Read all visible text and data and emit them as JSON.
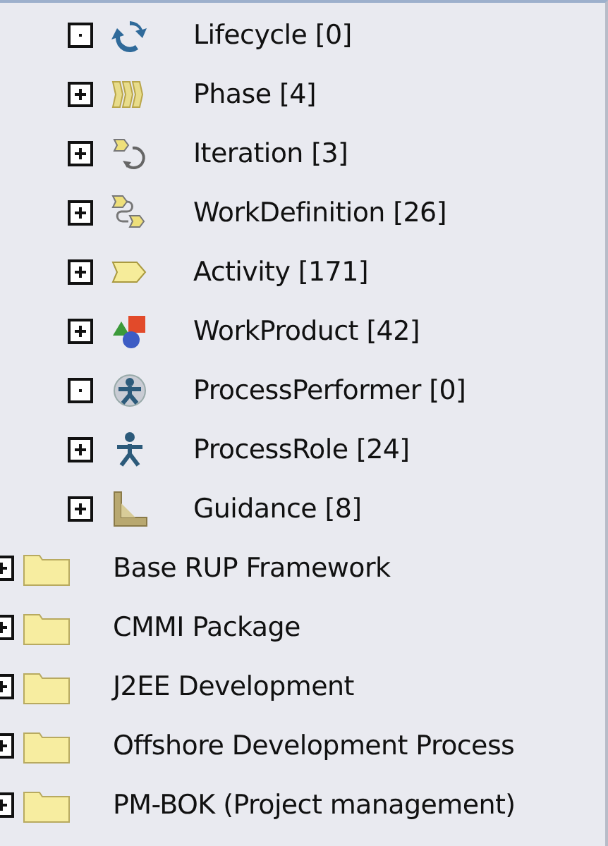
{
  "tree": {
    "nested_items": [
      {
        "label": "Lifecycle [0]",
        "kind": "lifecycle",
        "has_children": false
      },
      {
        "label": "Phase [4]",
        "kind": "phase",
        "has_children": true
      },
      {
        "label": "Iteration [3]",
        "kind": "iteration",
        "has_children": true
      },
      {
        "label": "WorkDefinition [26]",
        "kind": "work-definition",
        "has_children": true
      },
      {
        "label": "Activity [171]",
        "kind": "activity",
        "has_children": true
      },
      {
        "label": "WorkProduct [42]",
        "kind": "work-product",
        "has_children": true
      },
      {
        "label": "ProcessPerformer [0]",
        "kind": "process-performer",
        "has_children": false
      },
      {
        "label": "ProcessRole [24]",
        "kind": "process-role",
        "has_children": true
      },
      {
        "label": "Guidance [8]",
        "kind": "guidance",
        "has_children": true
      }
    ],
    "items": [
      {
        "label": "Base RUP Framework",
        "kind": "folder",
        "has_children": true
      },
      {
        "label": "CMMI Package",
        "kind": "folder",
        "has_children": true
      },
      {
        "label": "J2EE Development",
        "kind": "folder",
        "has_children": true
      },
      {
        "label": "Offshore Development Process",
        "kind": "folder",
        "has_children": true
      },
      {
        "label": "PM-BOK (Project management)",
        "kind": "folder",
        "has_children": true
      }
    ]
  }
}
